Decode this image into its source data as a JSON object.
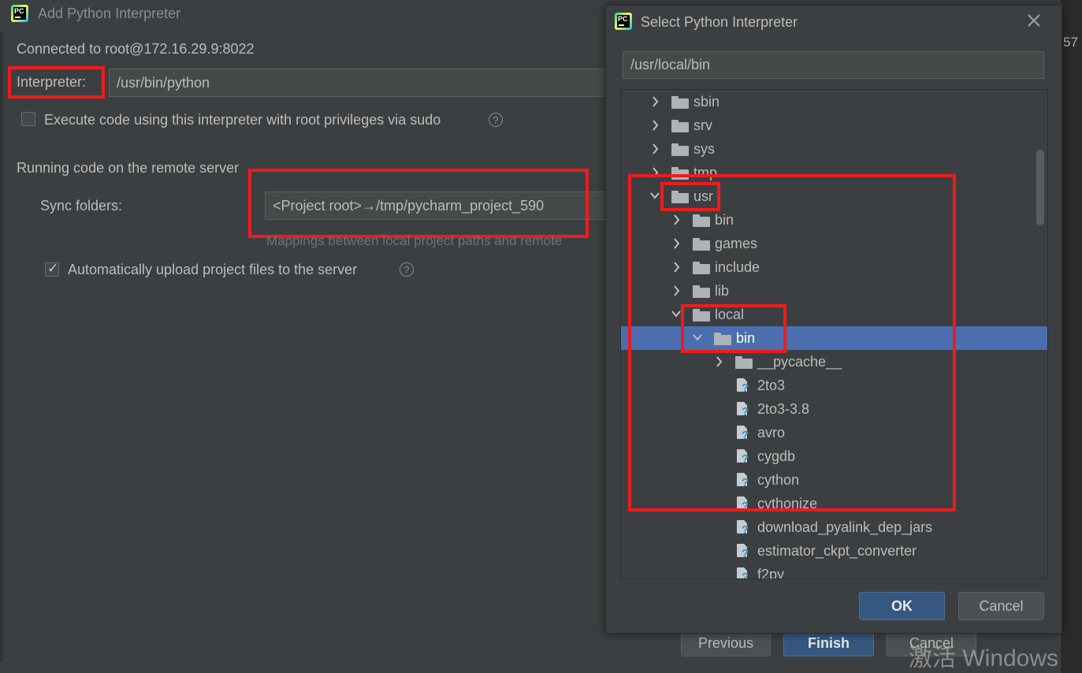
{
  "back_dialog": {
    "title": "Add Python Interpreter",
    "connected_text": "Connected to root@172.16.29.9:8022",
    "interpreter_label": "Interpreter:",
    "interpreter_value": "/usr/bin/python",
    "sudo_label": "Execute code using this interpreter with root privileges via sudo",
    "remote_section": "Running code on the remote server",
    "sync_label": "Sync folders:",
    "sync_value": "<Project root>→/tmp/pycharm_project_590",
    "mappings_hint": "Mappings between local project paths and remote",
    "auto_upload_label": "Automatically upload project files to the server",
    "help_glyph": "?",
    "buttons": {
      "previous": "Previous",
      "finish": "Finish",
      "cancel": "Cancel"
    },
    "edge_number": "57"
  },
  "front_dialog": {
    "title": "Select Python Interpreter",
    "path_value": "/usr/local/bin",
    "buttons": {
      "ok": "OK",
      "cancel": "Cancel"
    },
    "tree": [
      {
        "label": "sbin",
        "kind": "folder",
        "depth": 0,
        "expander": "collapsed"
      },
      {
        "label": "srv",
        "kind": "folder",
        "depth": 0,
        "expander": "collapsed"
      },
      {
        "label": "sys",
        "kind": "folder",
        "depth": 0,
        "expander": "collapsed"
      },
      {
        "label": "tmp",
        "kind": "folder",
        "depth": 0,
        "expander": "collapsed"
      },
      {
        "label": "usr",
        "kind": "folder",
        "depth": 0,
        "expander": "expanded"
      },
      {
        "label": "bin",
        "kind": "folder",
        "depth": 1,
        "expander": "collapsed"
      },
      {
        "label": "games",
        "kind": "folder",
        "depth": 1,
        "expander": "collapsed"
      },
      {
        "label": "include",
        "kind": "folder",
        "depth": 1,
        "expander": "collapsed"
      },
      {
        "label": "lib",
        "kind": "folder",
        "depth": 1,
        "expander": "collapsed"
      },
      {
        "label": "local",
        "kind": "folder",
        "depth": 1,
        "expander": "expanded"
      },
      {
        "label": "bin",
        "kind": "folder",
        "depth": 2,
        "expander": "expanded",
        "selected": true
      },
      {
        "label": "__pycache__",
        "kind": "folder",
        "depth": 3,
        "expander": "collapsed"
      },
      {
        "label": "2to3",
        "kind": "file",
        "depth": 3
      },
      {
        "label": "2to3-3.8",
        "kind": "file",
        "depth": 3
      },
      {
        "label": "avro",
        "kind": "file",
        "depth": 3
      },
      {
        "label": "cygdb",
        "kind": "file",
        "depth": 3
      },
      {
        "label": "cython",
        "kind": "file",
        "depth": 3
      },
      {
        "label": "cythonize",
        "kind": "file",
        "depth": 3
      },
      {
        "label": "download_pyalink_dep_jars",
        "kind": "file",
        "depth": 3
      },
      {
        "label": "estimator_ckpt_converter",
        "kind": "file",
        "depth": 3
      },
      {
        "label": "f2py",
        "kind": "file",
        "depth": 3
      }
    ]
  },
  "watermark": "激活 Windows",
  "colors": {
    "accent_red": "#ee1c1c",
    "selection": "#4b6eaf",
    "primary_button": "#365880"
  },
  "icons": {
    "app": "pycharm-logo-icon",
    "close": "close-icon",
    "folder": "folder-icon",
    "file": "python-file-icon",
    "chevron": "chevron-icon"
  }
}
